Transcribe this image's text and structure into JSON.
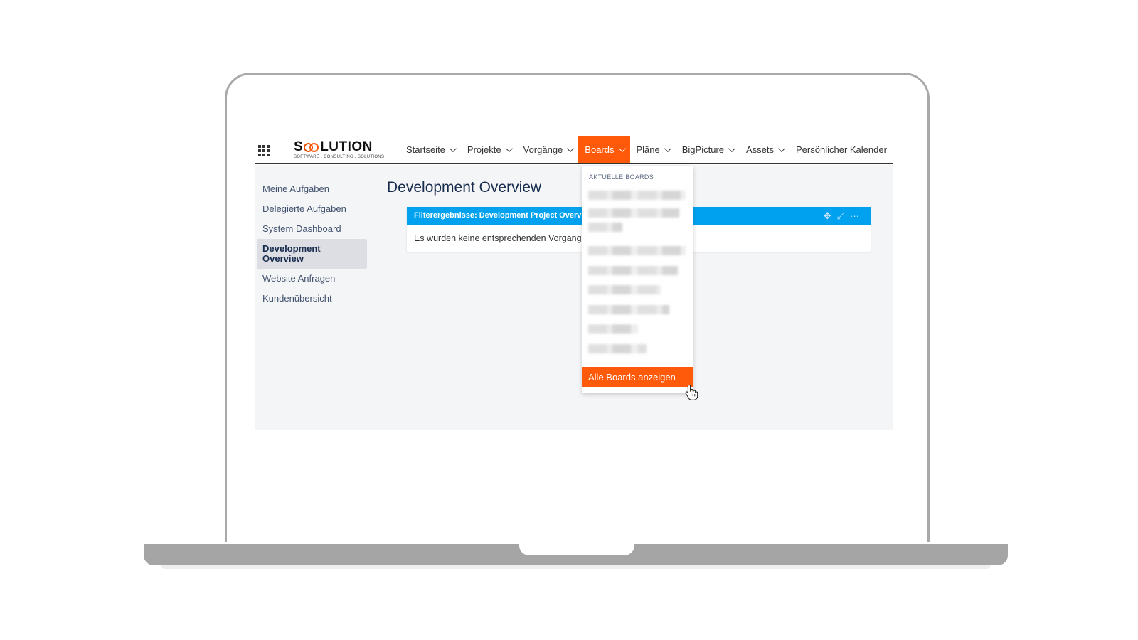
{
  "logo": {
    "text_before": "S",
    "text_after": "LUTION",
    "tagline": "SOFTWARE . CONSULTING . SOLUTIONS"
  },
  "nav": {
    "items": [
      {
        "label": "Startseite",
        "dropdown": true,
        "active": false
      },
      {
        "label": "Projekte",
        "dropdown": true,
        "active": false
      },
      {
        "label": "Vorgänge",
        "dropdown": true,
        "active": false
      },
      {
        "label": "Boards",
        "dropdown": true,
        "active": true
      },
      {
        "label": "Pläne",
        "dropdown": true,
        "active": false
      },
      {
        "label": "BigPicture",
        "dropdown": true,
        "active": false
      },
      {
        "label": "Assets",
        "dropdown": true,
        "active": false
      },
      {
        "label": "Persönlicher Kalender",
        "dropdown": false,
        "active": false
      }
    ]
  },
  "sidebar": {
    "items": [
      {
        "label": "Meine Aufgaben",
        "active": false
      },
      {
        "label": "Delegierte Aufgaben",
        "active": false
      },
      {
        "label": "System Dashboard",
        "active": false
      },
      {
        "label": "Development Overview",
        "active": true
      },
      {
        "label": "Website Anfragen",
        "active": false
      },
      {
        "label": "Kundenübersicht",
        "active": false
      }
    ]
  },
  "main": {
    "title": "Development Overview",
    "gadget": {
      "header": "Filterergebnisse: Development Project Overview",
      "body": "Es wurden keine entsprechenden Vorgänge gefunden."
    }
  },
  "boards_dropdown": {
    "header": "AKTUELLE BOARDS",
    "footer_label": "Alle Boards anzeigen"
  },
  "colors": {
    "accent": "#ff5a0a",
    "gadget_header": "#00a2f0",
    "text": "#172b4d"
  },
  "icons": {
    "apps": "grid-icon",
    "move": "move-icon",
    "maximize": "expand-icon",
    "more": "more-icon",
    "cursor": "hand-cursor-icon"
  }
}
